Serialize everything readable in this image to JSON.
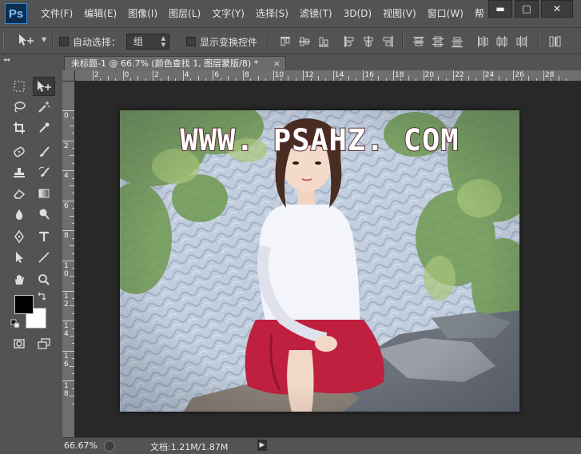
{
  "app": {
    "logo": "Ps"
  },
  "menu": [
    "文件(F)",
    "编辑(E)",
    "图像(I)",
    "图层(L)",
    "文字(Y)",
    "选择(S)",
    "滤镜(T)",
    "3D(D)",
    "视图(V)",
    "窗口(W)",
    "帮"
  ],
  "window_buttons": {
    "minimize": "▬",
    "maximize": "□",
    "close": "✕"
  },
  "options": {
    "auto_select_label": "自动选择：",
    "auto_select_value": "组",
    "show_transform_label": "显示变换控件"
  },
  "document": {
    "tab_title": "未标题-1 @ 66.7% (颜色查找 1, 图层蒙版/8) *",
    "tab_close": "×",
    "watermark": "WWW. PSAHZ. COM"
  },
  "ruler": {
    "top": [
      "2",
      "0",
      "2",
      "4",
      "6",
      "8",
      "10",
      "12",
      "14",
      "16",
      "18",
      "20",
      "22",
      "24",
      "26",
      "28"
    ],
    "left": [
      "0",
      "2",
      "4",
      "6",
      "8",
      "1\n0",
      "1\n2",
      "1\n4",
      "1\n6",
      "1\n8"
    ]
  },
  "colors": {
    "foreground": "#000000",
    "background": "#ffffff",
    "ui_bg": "#535353",
    "canvas_bg": "#282828"
  },
  "status": {
    "zoom": "66.67%",
    "doc_info": "文档:1.21M/1.87M",
    "arrow": "▶"
  },
  "tools": [
    "rect-marquee-icon",
    "move-icon",
    "lasso-icon",
    "magic-wand-icon",
    "crop-icon",
    "eyedropper-icon",
    "healing-brush-icon",
    "brush-icon",
    "clone-stamp-icon",
    "history-brush-icon",
    "eraser-icon",
    "gradient-icon",
    "blur-icon",
    "dodge-icon",
    "pen-icon",
    "type-icon",
    "path-select-icon",
    "line-icon",
    "hand-icon",
    "zoom-icon",
    "quick-mask-icon",
    "screen-mode-icon"
  ]
}
